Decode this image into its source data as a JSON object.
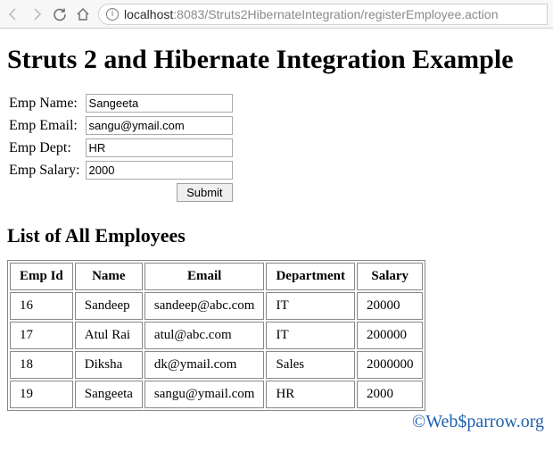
{
  "browser": {
    "url_host": "localhost",
    "url_port": ":8083",
    "url_path": "/Struts2HibernateIntegration/registerEmployee.action"
  },
  "page": {
    "title": "Struts 2 and Hibernate Integration Example",
    "list_title": "List of All Employees"
  },
  "form": {
    "name_label": "Emp Name:",
    "name_value": "Sangeeta",
    "email_label": "Emp Email:",
    "email_value": "sangu@ymail.com",
    "dept_label": "Emp Dept:",
    "dept_value": "HR",
    "salary_label": "Emp Salary:",
    "salary_value": "2000",
    "submit_label": "Submit"
  },
  "table": {
    "headers": {
      "id": "Emp Id",
      "name": "Name",
      "email": "Email",
      "dept": "Department",
      "salary": "Salary"
    },
    "rows": [
      {
        "id": "16",
        "name": "Sandeep",
        "email": "sandeep@abc.com",
        "dept": "IT",
        "salary": "20000"
      },
      {
        "id": "17",
        "name": "Atul Rai",
        "email": "atul@abc.com",
        "dept": "IT",
        "salary": "200000"
      },
      {
        "id": "18",
        "name": "Diksha",
        "email": "dk@ymail.com",
        "dept": "Sales",
        "salary": "2000000"
      },
      {
        "id": "19",
        "name": "Sangeeta",
        "email": "sangu@ymail.com",
        "dept": "HR",
        "salary": "2000"
      }
    ]
  },
  "watermark": "©Web$parrow.org"
}
